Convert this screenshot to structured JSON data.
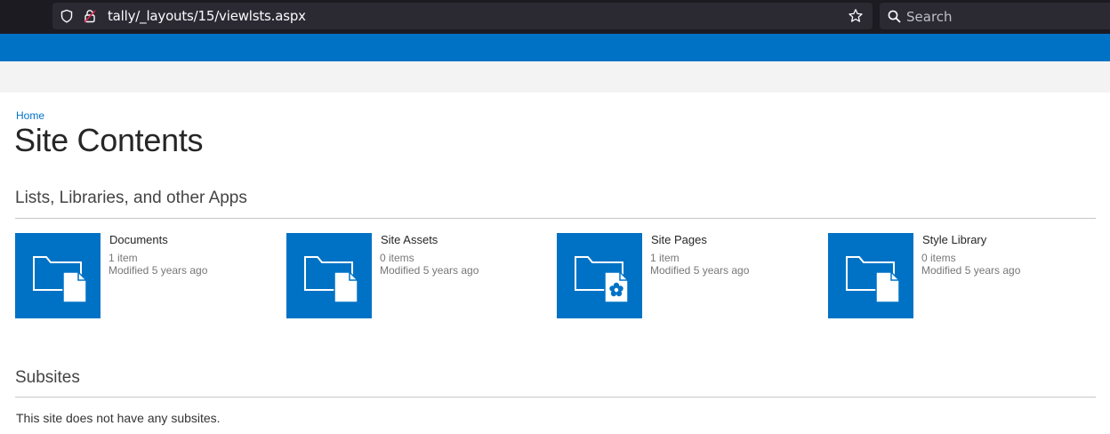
{
  "browser": {
    "url": "tally/_layouts/15/viewlsts.aspx",
    "search_placeholder": "Search"
  },
  "colors": {
    "accent": "#0072c6",
    "chrome_bg": "#1c1b22",
    "urlbar_bg": "#2b2a33",
    "ribbon_bg": "#f3f3f3"
  },
  "breadcrumb": {
    "home": "Home"
  },
  "page": {
    "title": "Site Contents"
  },
  "apps_section": {
    "heading": "Lists, Libraries, and other Apps",
    "tiles": [
      {
        "name": "Documents",
        "count": "1 item",
        "modified": "Modified 5 years ago",
        "icon": "document-library-icon"
      },
      {
        "name": "Site Assets",
        "count": "0 items",
        "modified": "Modified 5 years ago",
        "icon": "document-library-icon"
      },
      {
        "name": "Site Pages",
        "count": "1 item",
        "modified": "Modified 5 years ago",
        "icon": "site-pages-library-icon"
      },
      {
        "name": "Style Library",
        "count": "0 items",
        "modified": "Modified 5 years ago",
        "icon": "document-library-icon"
      }
    ]
  },
  "subsites_section": {
    "heading": "Subsites",
    "empty_message": "This site does not have any subsites."
  }
}
